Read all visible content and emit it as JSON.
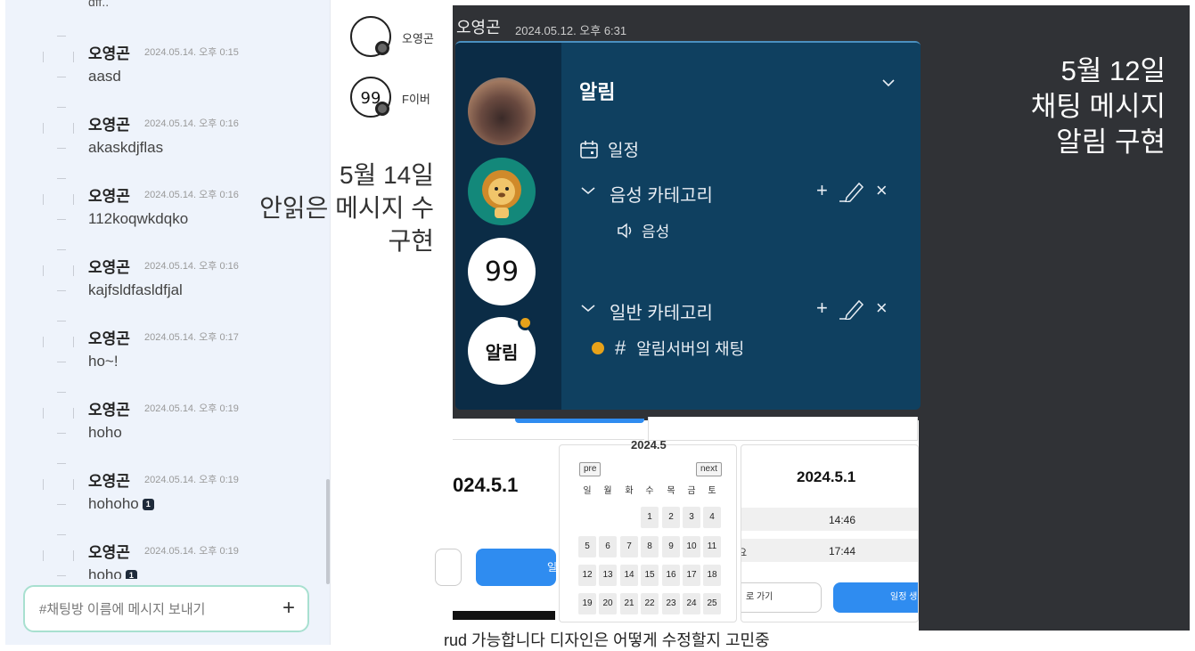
{
  "chat": {
    "top_cut_text": "dff..",
    "messages": [
      {
        "name": "오영곤",
        "time": "2024.05.14. 오후 0:15",
        "text": "aasd",
        "unread": ""
      },
      {
        "name": "오영곤",
        "time": "2024.05.14. 오후 0:16",
        "text": "akaskdjflas",
        "unread": ""
      },
      {
        "name": "오영곤",
        "time": "2024.05.14. 오후 0:16",
        "text": "112koqwkdqko",
        "unread": ""
      },
      {
        "name": "오영곤",
        "time": "2024.05.14. 오후 0:16",
        "text": "kajfsldfasldfjal",
        "unread": ""
      },
      {
        "name": "오영곤",
        "time": "2024.05.14. 오후 0:17",
        "text": "ho~!",
        "unread": ""
      },
      {
        "name": "오영곤",
        "time": "2024.05.14. 오후 0:19",
        "text": "hoho",
        "unread": ""
      },
      {
        "name": "오영곤",
        "time": "2024.05.14. 오후 0:19",
        "text": "hohoho",
        "unread": "1"
      },
      {
        "name": "오영곤",
        "time": "2024.05.14. 오후 0:19",
        "text": "hoho",
        "unread": "1"
      }
    ],
    "input_placeholder": "#채팅방 이름에 메시지 보내기",
    "send_plus": "+"
  },
  "members": [
    {
      "name": "오영곤",
      "icon": "user-avatar-icon"
    },
    {
      "name": "F이버",
      "icon": "ninety-nine-avatar-icon"
    }
  ],
  "notes": {
    "may14": [
      "5월 14일",
      "안읽은 메시지 수",
      "구현"
    ],
    "may12": [
      "5월 12일",
      "채팅 메시지",
      "알림 구현"
    ]
  },
  "header": {
    "name": "오영곤",
    "time": "2024.05.12. 오후 6:31"
  },
  "server": {
    "icons": [
      "photo-server-icon",
      "lion-server-icon",
      "ninety-nine-server-icon",
      "alarm-server-icon"
    ],
    "alarm_label": "알림",
    "title": "알림",
    "schedule": "일정",
    "voice_category": "음성 카테고리",
    "voice_channel": "음성",
    "text_category": "일반 카테고리",
    "text_channel": "알림서버의 채팅",
    "accent": "#e7a21a",
    "bg": "#0f4060",
    "rail_bg": "#0b2c46"
  },
  "lower": {
    "date_big": "024.5.1",
    "cal_title": "2024.5",
    "pre": "pre",
    "next": "next",
    "weekdays": [
      "일",
      "월",
      "화",
      "수",
      "목",
      "금",
      "토"
    ],
    "week1": [
      "1",
      "2",
      "3",
      "4"
    ],
    "week2": [
      "5",
      "6",
      "7",
      "8",
      "9",
      "10",
      "11"
    ],
    "week3": [
      "12",
      "13",
      "14",
      "15",
      "16",
      "17",
      "18"
    ],
    "week4": [
      "19",
      "20",
      "21",
      "22",
      "23",
      "24",
      "25"
    ],
    "right_date": "2024.5.1",
    "rows": [
      {
        "k": "",
        "v": "14:46"
      },
      {
        "k": "요",
        "v": "17:44"
      }
    ],
    "back_btn": "로 가기",
    "make_btn": "일정 생",
    "left_btn": "일"
  },
  "caption": "rud 가능합니다  디자인은 어떻게 수정할지 고민중"
}
